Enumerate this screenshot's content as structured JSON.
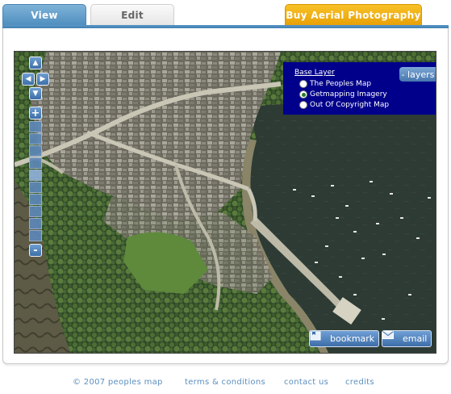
{
  "tabs": {
    "view": "View",
    "edit": "Edit",
    "buy": "Buy Aerial Photography"
  },
  "map": {
    "layer_switcher": {
      "title": "Base Layer",
      "options": [
        "The Peoples Map",
        "Getmapping Imagery",
        "Out Of Copyright Map"
      ],
      "selected": "Getmapping Imagery"
    },
    "layers_button": "- layers",
    "zoom_in": "+",
    "zoom_out": "-",
    "bookmark_label": "bookmark",
    "email_label": "email"
  },
  "footer": {
    "copyright": "© 2007 peoples map",
    "terms": "terms & conditions",
    "contact": "contact us",
    "credits": "credits"
  },
  "colors": {
    "tab_view": "#4f8fc0",
    "tab_buy": "#e8a106",
    "layer_panel": "#00008b",
    "footer_link": "#5b8fbf"
  }
}
